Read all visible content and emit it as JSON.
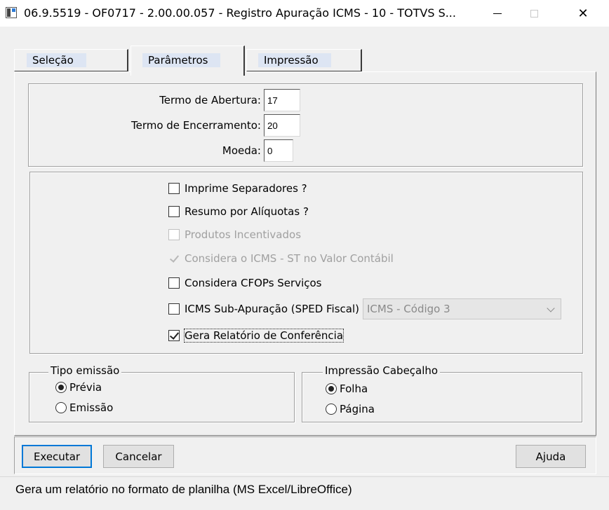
{
  "window": {
    "title": "06.9.5519 - OF0717 - 2.00.00.057 - Registro Apuração ICMS - 10 - TOTVS S...",
    "close_glyph": "✕"
  },
  "tabs": [
    {
      "label": "Seleção",
      "active": false
    },
    {
      "label": "Parâmetros",
      "active": true
    },
    {
      "label": "Impressão",
      "active": false
    }
  ],
  "terms": {
    "abertura_label": "Termo de Abertura:",
    "abertura_value": "17",
    "encerramento_label": "Termo de Encerramento:",
    "encerramento_value": "20",
    "moeda_label": "Moeda:",
    "moeda_value": "0"
  },
  "options": [
    {
      "label": "Imprime Separadores ?",
      "checked": false,
      "enabled": true
    },
    {
      "label": "Resumo por Alíquotas ?",
      "checked": false,
      "enabled": true
    },
    {
      "label": "Produtos Incentivados",
      "checked": false,
      "enabled": false
    },
    {
      "label": "Considera o ICMS - ST no Valor Contábil",
      "checked": true,
      "enabled": false
    },
    {
      "label": "Considera CFOPs Serviços",
      "checked": false,
      "enabled": true
    },
    {
      "label": "ICMS Sub-Apuração (SPED Fiscal)",
      "checked": false,
      "enabled": true
    },
    {
      "label": "Gera Relatório de Conferência",
      "checked": true,
      "enabled": true,
      "focused": true
    }
  ],
  "icms_select": {
    "value": "ICMS - Código 3",
    "enabled": false
  },
  "tipo_emissao": {
    "legend": "Tipo emissão",
    "options": [
      {
        "label": "Prévia",
        "selected": true
      },
      {
        "label": "Emissão",
        "selected": false
      }
    ]
  },
  "impressao_cabecalho": {
    "legend": "Impressão Cabeçalho",
    "options": [
      {
        "label": "Folha",
        "selected": true
      },
      {
        "label": "Página",
        "selected": false
      }
    ]
  },
  "buttons": {
    "executar": "Executar",
    "cancelar": "Cancelar",
    "ajuda": "Ajuda"
  },
  "status_text": "Gera um relatório no formato de planilha (MS Excel/LibreOffice)"
}
